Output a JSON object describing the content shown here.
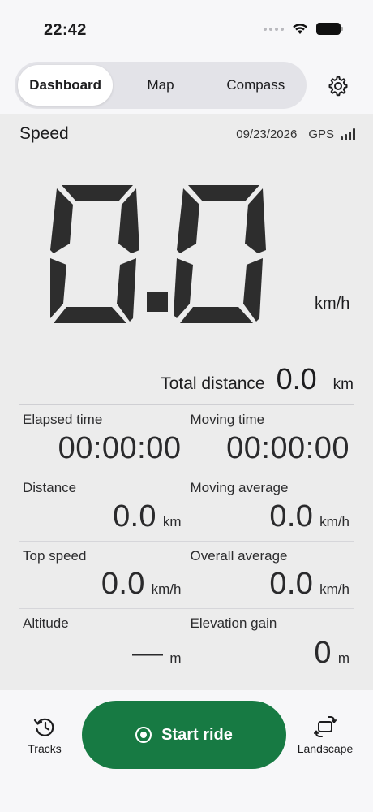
{
  "status_bar": {
    "time": "22:42"
  },
  "tabs": [
    {
      "label": "Dashboard",
      "active": true
    },
    {
      "label": "Map",
      "active": false
    },
    {
      "label": "Compass",
      "active": false
    }
  ],
  "settings_icon": "gear-icon",
  "speed_panel": {
    "title": "Speed",
    "date": "09/23/2026",
    "gps_label": "GPS",
    "speed_value": "0.0",
    "speed_unit": "km/h"
  },
  "total_distance": {
    "label": "Total distance",
    "value": "0.0",
    "unit": "km"
  },
  "stats": [
    {
      "label": "Elapsed time",
      "value": "00:00:00",
      "unit": ""
    },
    {
      "label": "Moving time",
      "value": "00:00:00",
      "unit": ""
    },
    {
      "label": "Distance",
      "value": "0.0",
      "unit": "km"
    },
    {
      "label": "Moving average",
      "value": "0.0",
      "unit": "km/h"
    },
    {
      "label": "Top speed",
      "value": "0.0",
      "unit": "km/h"
    },
    {
      "label": "Overall average",
      "value": "0.0",
      "unit": "km/h"
    },
    {
      "label": "Altitude",
      "value": "—",
      "unit": "m"
    },
    {
      "label": "Elevation gain",
      "value": "0",
      "unit": "m"
    }
  ],
  "bottom_bar": {
    "tracks_label": "Tracks",
    "start_label": "Start ride",
    "landscape_label": "Landscape"
  },
  "colors": {
    "accent_green": "#177a43",
    "panel_bg": "#ececec",
    "lcd_segment": "#2d2d2d"
  }
}
